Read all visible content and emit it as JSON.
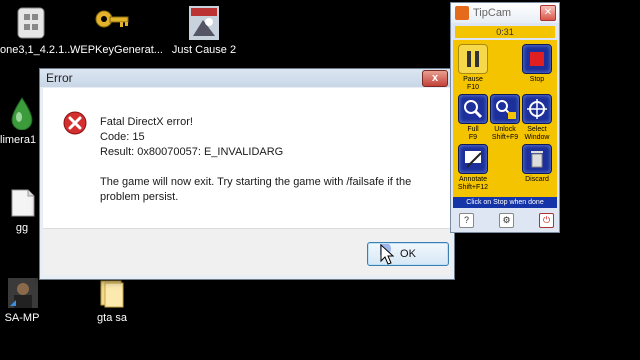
{
  "desktop": {
    "icons": [
      {
        "label": "one3,1_4.2.1...",
        "icon": "cube-icon"
      },
      {
        "label": "WEPKeyGenerat...",
        "icon": "key-icon"
      },
      {
        "label": "Just Cause 2",
        "icon": "game-cover-icon"
      },
      {
        "label": "limera1",
        "icon": "green-drop-icon"
      },
      {
        "label": "gg",
        "icon": "document-icon"
      },
      {
        "label": "SA-MP",
        "icon": "samp-icon"
      },
      {
        "label": "gta sa",
        "icon": "folder-icon"
      }
    ]
  },
  "dialog": {
    "title": "Error",
    "close_glyph": "x",
    "lines": [
      "Fatal DirectX error!",
      "Code: 15",
      "Result: 0x80070057: E_INVALIDARG"
    ],
    "message_lines": [
      "The game will now exit. Try starting the game with /failsafe if the",
      "problem persist."
    ],
    "ok_label": "OK"
  },
  "tipcam": {
    "title": "TipCam",
    "timer": "0:31",
    "buttons": [
      {
        "label": "Pause",
        "sub": "F10"
      },
      {
        "label": "Stop",
        "sub": ""
      },
      {
        "label": "Full",
        "sub": "F9"
      },
      {
        "label": "Unlock",
        "sub": "Shift+F9"
      },
      {
        "label": "Select",
        "sub": "Window"
      },
      {
        "label": "Annotate",
        "sub": "Shift+F12"
      },
      {
        "label": "Discard",
        "sub": ""
      }
    ],
    "status": "Click on Stop when done",
    "footer": {
      "help": "?",
      "settings": "⚙",
      "power": "⏻"
    }
  },
  "colors": {
    "tipcam_yellow": "#f5c400",
    "tipcam_blue": "#1c2f9a",
    "error_red": "#d32f2f",
    "desktop_bg": "#000000"
  }
}
